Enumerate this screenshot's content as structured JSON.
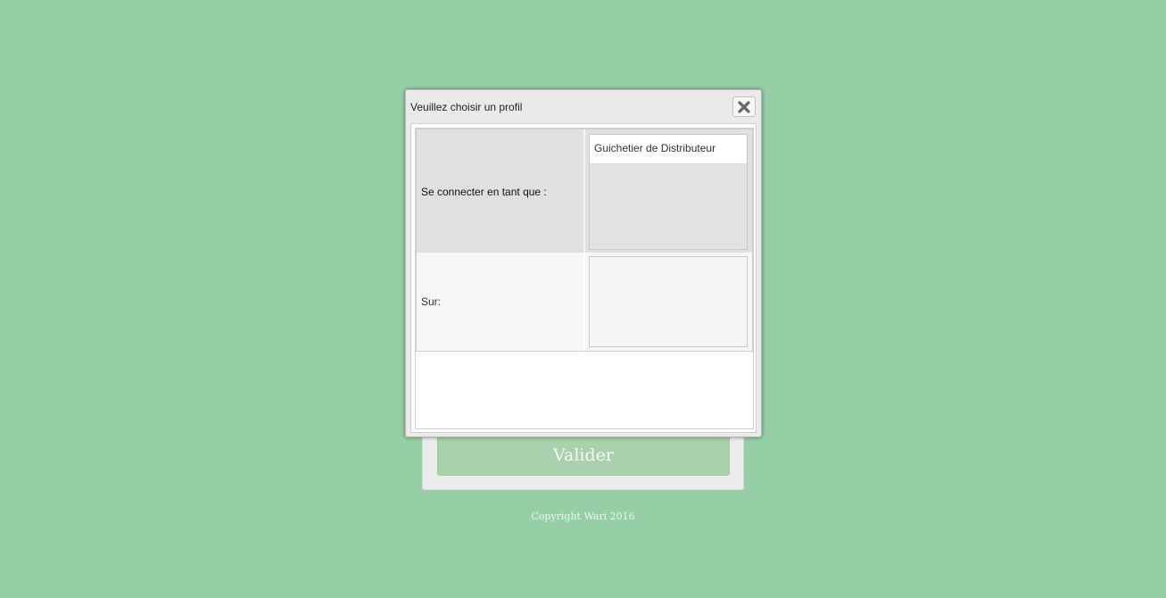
{
  "background_color": "#96cfa6",
  "login": {
    "submit_label": "Valider",
    "copyright": "Copyright Wari 2016"
  },
  "dialog": {
    "title": "Veuillez choisir un profil",
    "close_icon": "close-icon",
    "rows": [
      {
        "label": "Se connecter en tant que :",
        "options": [
          "Guichetier de Distributeur"
        ]
      },
      {
        "label": "Sur:",
        "options": []
      }
    ]
  }
}
